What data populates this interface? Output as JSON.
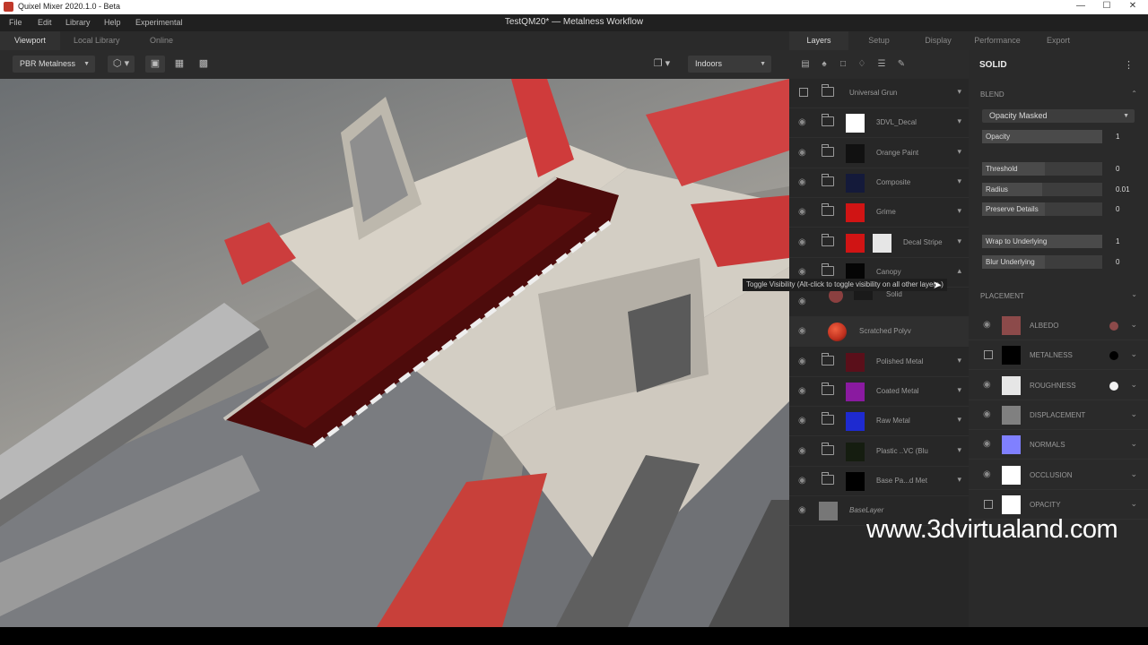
{
  "window": {
    "app_title": "Quixel Mixer 2020.1.0 - Beta",
    "doc_title": "TestQM20* — Metalness Workflow",
    "controls": {
      "minimize": "—",
      "maximize": "☐",
      "close": "✕"
    }
  },
  "menu": [
    "File",
    "Edit",
    "Library",
    "Help",
    "Experimental"
  ],
  "viewport_tabs": [
    "Viewport",
    "Local Library",
    "Online"
  ],
  "viewport_toolbar": {
    "shading_mode": "PBR Metalness",
    "environment": "Indoors"
  },
  "right_tabs": [
    "Layers",
    "Setup",
    "Display",
    "Performance",
    "Export"
  ],
  "layers_toolbar_icons": [
    "layer-stack-icon",
    "paint-layer-icon",
    "fill-layer-icon",
    "drop-icon",
    "adjust-layers-icon",
    "brush-icon"
  ],
  "layers": [
    {
      "name": "Universal Grun",
      "thumb": "none",
      "type": "folder",
      "checkbox": true,
      "chevron": "▾"
    },
    {
      "name": "3DVL_Decal",
      "thumb": "#ffffff",
      "type": "folder",
      "chevron": "▾"
    },
    {
      "name": "Orange Paint",
      "thumb": "#111111",
      "type": "folder",
      "chevron": "▾"
    },
    {
      "name": "Composite",
      "thumb": "#141a3a",
      "type": "folder",
      "chevron": "▾"
    },
    {
      "name": "Grime",
      "thumb": "#d01414",
      "type": "folder",
      "chevron": "▾"
    },
    {
      "name": "Decal Stripe",
      "thumb": "#d01414",
      "thumb2": "#e6e6e6",
      "type": "folder",
      "chevron": "▾"
    },
    {
      "name": "Canopy",
      "thumb": "#050505",
      "type": "folder",
      "chevron": "▴"
    },
    {
      "name": "Solid",
      "thumb": "#8b4040",
      "thumb2": "#1a1a1a",
      "type": "sub",
      "chevron": ""
    },
    {
      "name": "Scratched Polyv",
      "thumb": "#c0301e",
      "type": "material",
      "chevron": ""
    },
    {
      "name": "Polished Metal",
      "thumb": "#5a0f1a",
      "type": "folder",
      "chevron": "▾"
    },
    {
      "name": "Coated Metal",
      "thumb": "#8a1aa0",
      "type": "folder",
      "chevron": "▾"
    },
    {
      "name": "Raw Metal",
      "thumb": "#1e2ad0",
      "type": "folder",
      "chevron": "▾"
    },
    {
      "name": "Plastic ..VC (Blu",
      "thumb": "#151d10",
      "type": "folder",
      "chevron": "▾"
    },
    {
      "name": "Base Pa...d Met",
      "thumb": "#000000",
      "type": "folder",
      "chevron": "▾"
    },
    {
      "name": "BaseLayer",
      "thumb": "#777777",
      "type": "base",
      "chevron": ""
    }
  ],
  "tooltip": "Toggle Visibility (Alt-click to toggle visibility on all other layers.)",
  "properties": {
    "title": "SOLID",
    "blend_section": "BLEND",
    "blend_mode": "Opacity Masked",
    "fields": [
      {
        "label": "Opacity",
        "value": "1",
        "fill": 1.0
      },
      {
        "label": "Threshold",
        "value": "0",
        "fill": 0.0
      },
      {
        "label": "Radius",
        "value": "0.01",
        "fill": 0.01
      },
      {
        "label": "Preserve Details",
        "value": "0",
        "fill": 0.0
      },
      {
        "label": "Wrap to Underlying",
        "value": "1",
        "fill": 1.0
      },
      {
        "label": "Blur Underlying",
        "value": "0",
        "fill": 0.0
      }
    ],
    "placement_section": "PLACEMENT",
    "channels": [
      {
        "label": "ALBEDO",
        "swatch": "#8c4a4a",
        "dot": "#8c4a4a",
        "visible": true
      },
      {
        "label": "METALNESS",
        "swatch": "#000000",
        "dot": "#000000",
        "visible": false
      },
      {
        "label": "ROUGHNESS",
        "swatch": "#e6e6e6",
        "dot": "#f2f2f2",
        "visible": true
      },
      {
        "label": "DISPLACEMENT",
        "swatch": "#808080",
        "dot": "",
        "visible": true
      },
      {
        "label": "NORMALS",
        "swatch": "#8080ff",
        "dot": "",
        "visible": true
      },
      {
        "label": "OCCLUSION",
        "swatch": "#ffffff",
        "dot": "",
        "visible": true
      },
      {
        "label": "OPACITY",
        "swatch": "#ffffff",
        "dot": "",
        "visible": false
      }
    ]
  },
  "watermark": "www.3dvirtualand.com",
  "colors": {
    "accent_red": "#d33a3a",
    "panel_bg": "#272727",
    "canopy_red": "#5a0c0c"
  }
}
